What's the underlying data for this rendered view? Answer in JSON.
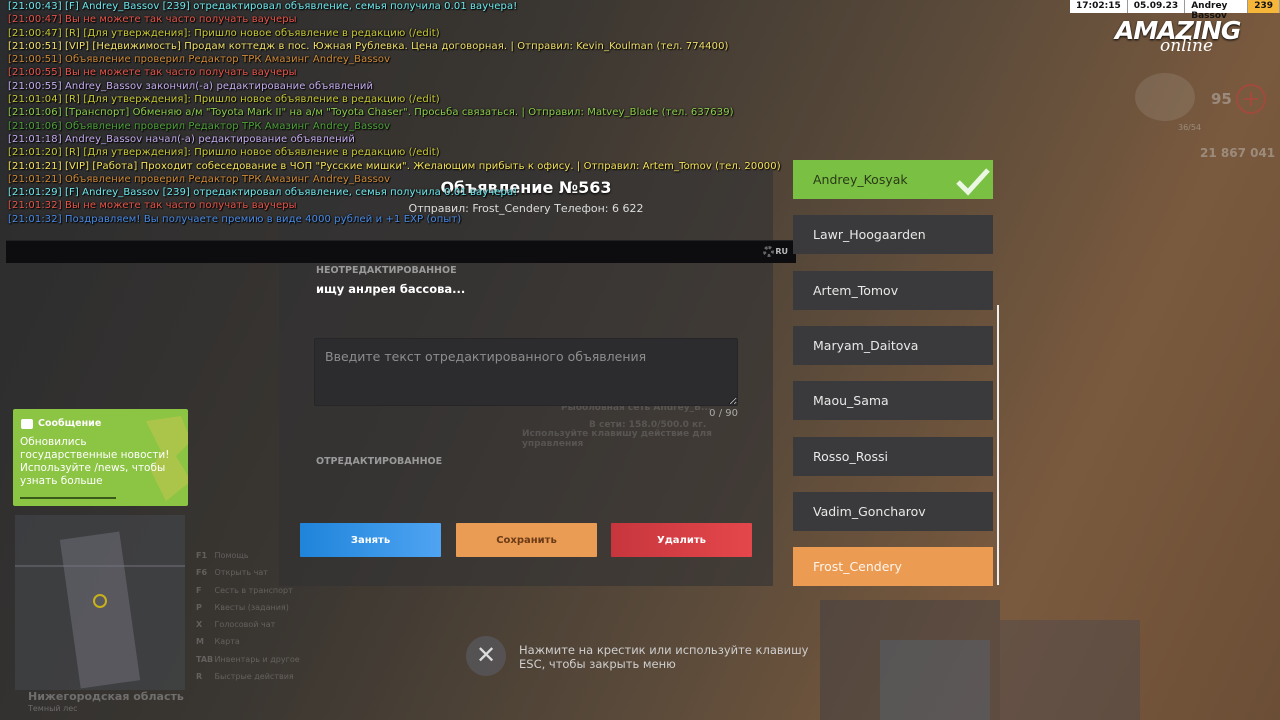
{
  "chat": [
    {
      "text": "[21:00:43] [F] Andrey_Bassov [239] отредактировал объявление, семья получила 0.01 ваучера!",
      "color": "#6ee8ee"
    },
    {
      "text": "[21:00:47] Вы не можете так часто получать ваучеры",
      "color": "#e8564a"
    },
    {
      "text": "[21:00:47] [R] [Для утверждения]: Пришло новое объявление в редакцию (/edit)",
      "color": "#c9c936"
    },
    {
      "text": "[21:00:51] [VIP] [Недвижимость] Продам коттедж в пос. Южная Рублевка. Цена договорная. | Отправил: Kevin_Koulman (тел. 774400)",
      "color": "#f2e06a"
    },
    {
      "text": "[21:00:51] Объявление проверил Редактор ТРК Амазинг Andrey_Bassov",
      "color": "#d08b38"
    },
    {
      "text": "[21:00:55] Вы не можете так часто получать ваучеры",
      "color": "#e8564a"
    },
    {
      "text": "[21:00:55] Andrey_Bassov закончил(-а) редактирование объявлений",
      "color": "#c6aef0"
    },
    {
      "text": "[21:01:04] [R] [Для утверждения]: Пришло новое объявление в редакцию (/edit)",
      "color": "#c9c936"
    },
    {
      "text": "[21:01:06] [Транспорт] Обменяю а/м \"Toyota Mark II\" на а/м \"Toyota Chaser\". Просьба связаться. | Отправил: Matvey_Blade (тел. 637639)",
      "color": "#8ccf4b"
    },
    {
      "text": "[21:01:06] Объявление проверил Редактор ТРК Амазинг Andrey_Bassov",
      "color": "#4fa33a"
    },
    {
      "text": "[21:01:18] Andrey_Bassov начал(-а) редактирование объявлений",
      "color": "#c6aef0"
    },
    {
      "text": "[21:01:20] [R] [Для утверждения]: Пришло новое объявление в редакцию (/edit)",
      "color": "#c9c936"
    },
    {
      "text": "[21:01:21] [VIP] [Работа] Проходит собеседование в ЧОП \"Русские мишки\". Желающим прибыть к офису. | Отправил: Artem_Tomov (тел. 20000)",
      "color": "#f6e35a"
    },
    {
      "text": "[21:01:21] Объявление проверил Редактор ТРК Амазинг Andrey_Bassov",
      "color": "#d08b38"
    },
    {
      "text": "[21:01:29] [F] Andrey_Bassov [239] отредактировал объявление, семья получила 0.01 ваучера!",
      "color": "#6ee8ee"
    },
    {
      "text": "[21:01:32] Вы не можете так часто получать ваучеры",
      "color": "#e8564a"
    },
    {
      "text": "[21:01:32] Поздравляем! Вы получаете премию в виде 4000 рублей и +1 EXP (опыт)",
      "color": "#4a8ce8"
    }
  ],
  "chat_input": {
    "lang": "RU"
  },
  "ad": {
    "title": "Объявление №563",
    "sender": "Отправил: Frost_Cendery Телефон: 6 622",
    "original_label": "НЕОТРЕДАКТИРОВАННОЕ",
    "original_text": "ищу анлрея бассова...",
    "edit_placeholder": "Введите текст отредактированного объявления",
    "counter": "0 / 90",
    "edited_label": "ОТРЕДАКТИРОВАННОЕ",
    "btn_take": "Занять",
    "btn_save": "Сохранить",
    "btn_delete": "Удалить"
  },
  "background_text": {
    "shop_name": "Рыболовная сеть Andrey_B...",
    "online": "В сети: 158.0/500.0 кг.",
    "use_hint": "Используйте клавишу действие для управления"
  },
  "players": [
    {
      "name": "Andrey_Kosyak",
      "state": "selected"
    },
    {
      "name": "Lawr_Hoogaarden",
      "state": "normal"
    },
    {
      "name": "Artem_Tomov",
      "state": "normal"
    },
    {
      "name": "Maryam_Daitova",
      "state": "normal"
    },
    {
      "name": "Maou_Sama",
      "state": "normal"
    },
    {
      "name": "Rosso_Rossi",
      "state": "normal"
    },
    {
      "name": "Vadim_Goncharov",
      "state": "normal"
    },
    {
      "name": "Frost_Cendery",
      "state": "sender"
    }
  ],
  "hud": {
    "time": "17:02:15",
    "date": "05.09.23",
    "player": "Andrey Bassov",
    "level": "239",
    "logo_top": "AMAZING",
    "logo_bottom": "online",
    "hp": "95",
    "ammo": "36/54",
    "money": "21 867 041"
  },
  "notification": {
    "title": "Сообщение",
    "body": "Обновились государственные новости! Используйте /news, чтобы узнать больше"
  },
  "map": {
    "region": "Нижегородская область",
    "sub_region": "Темный лес"
  },
  "hints": [
    {
      "key": "F1",
      "label": "Помощь"
    },
    {
      "key": "F6",
      "label": "Открыть чат"
    },
    {
      "key": "F",
      "label": "Сесть в транспорт"
    },
    {
      "key": "P",
      "label": "Квесты (задания)"
    },
    {
      "key": "X",
      "label": "Голосовой чат"
    },
    {
      "key": "M",
      "label": "Карта"
    },
    {
      "key": "TAB",
      "label": "Инвентарь и другое"
    },
    {
      "key": "R",
      "label": "Быстрые действия"
    }
  ],
  "close": {
    "icon": "close-icon",
    "hint": "Нажмите на крестик или используйте клавишу ESC, чтобы закрыть меню"
  },
  "colors": {
    "selected": "#7ac143",
    "sender": "#eb9b52",
    "take": "#2a8ee0",
    "save": "#ea9c55",
    "delete": "#d63d43",
    "notify": "#8cc443"
  }
}
